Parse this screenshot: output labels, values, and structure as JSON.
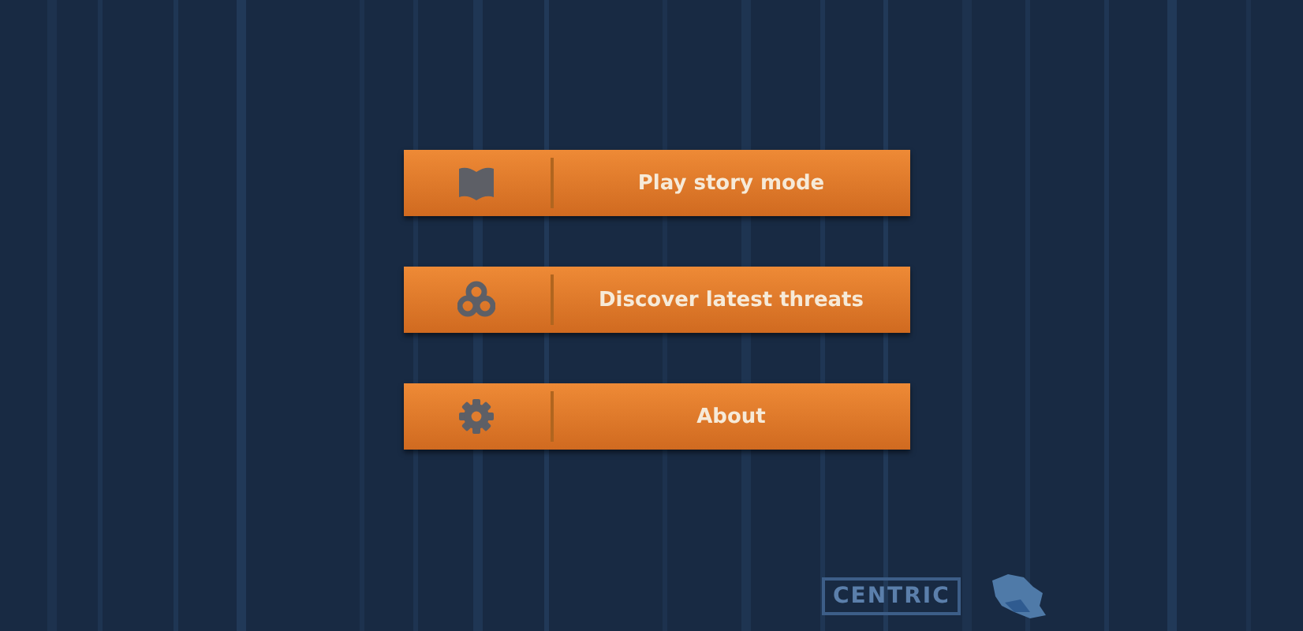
{
  "menu": [
    {
      "label": "Play story mode"
    },
    {
      "label": "Discover latest threats"
    },
    {
      "label": "About"
    }
  ],
  "footer": {
    "logo_text": "CENTRIC"
  }
}
